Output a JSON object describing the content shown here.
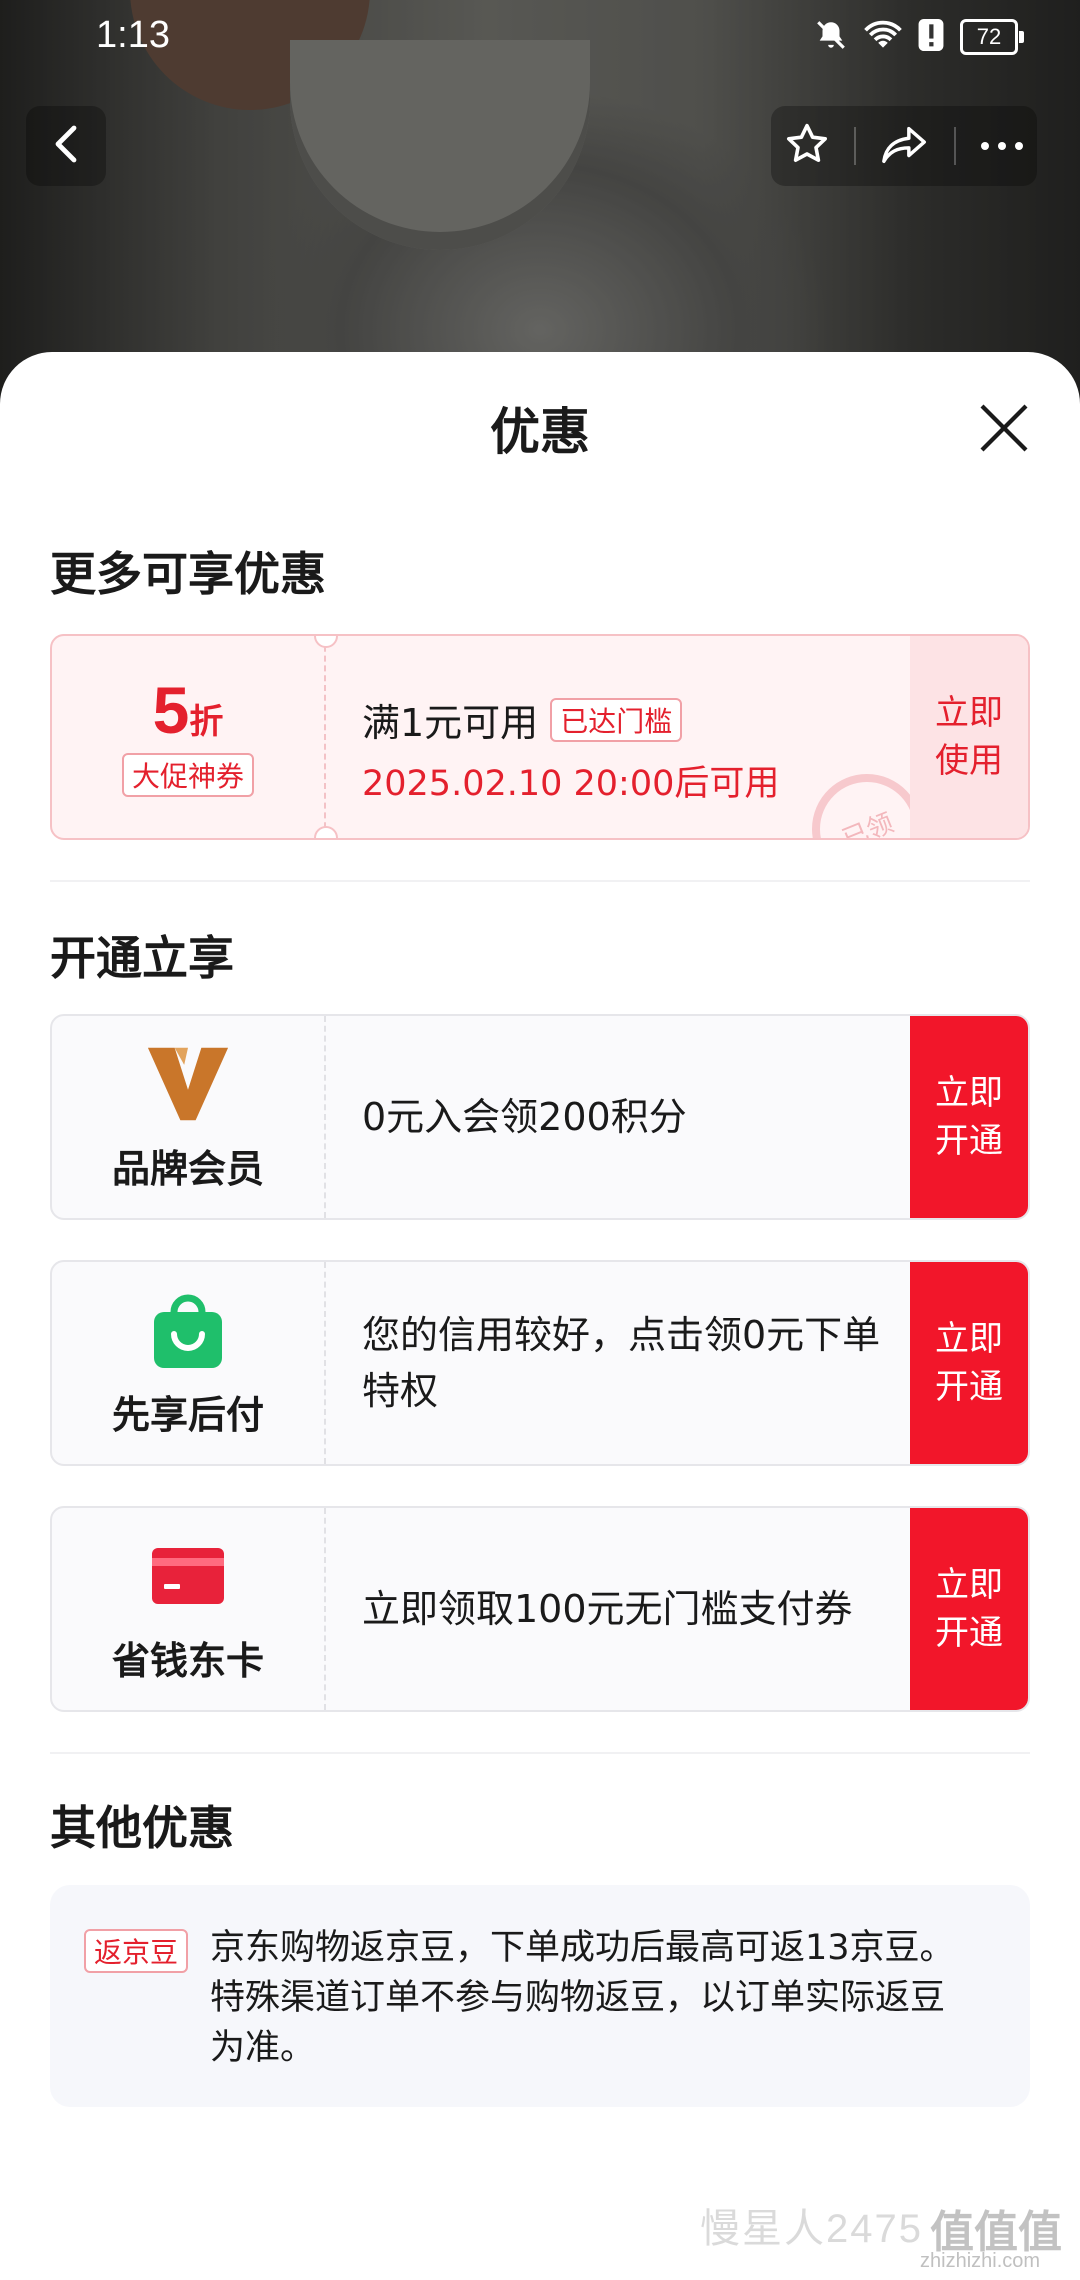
{
  "status_bar": {
    "time": "1:13",
    "battery": "72"
  },
  "sheet": {
    "title": "优惠"
  },
  "sections": {
    "more": "更多可享优惠",
    "open": "开通立享",
    "other": "其他优惠"
  },
  "coupon": {
    "discount_value": "5",
    "discount_unit": "折",
    "tag": "大促神券",
    "condition": "满1元可用",
    "badge": "已达门槛",
    "date": "2025.02.10 20:00后可用",
    "stamp": "已领",
    "action": "立即使用"
  },
  "offers": [
    {
      "name": "品牌会员",
      "text": "0元入会领200积分",
      "action": "立即开通",
      "icon": "brand-member-icon"
    },
    {
      "name": "先享后付",
      "text": "您的信用较好，点击领0元下单特权",
      "action": "立即开通",
      "icon": "shopping-bag-icon"
    },
    {
      "name": "省钱东卡",
      "text": "立即领取100元无门槛支付券",
      "action": "立即开通",
      "icon": "card-icon"
    }
  ],
  "other": {
    "tag": "返京豆",
    "text": "京东购物返京豆，下单成功后最高可返13京豆。特殊渠道订单不参与购物返豆，以订单实际返豆为准。"
  },
  "watermark": {
    "text": "慢星人2475",
    "logo": "值值值",
    "site": "zhizhizhi.com"
  },
  "colors": {
    "accent": "#f2162a",
    "coupon_bg": "#fff3f4",
    "brand_gold": "#c9762a",
    "green": "#1fbf6b"
  }
}
